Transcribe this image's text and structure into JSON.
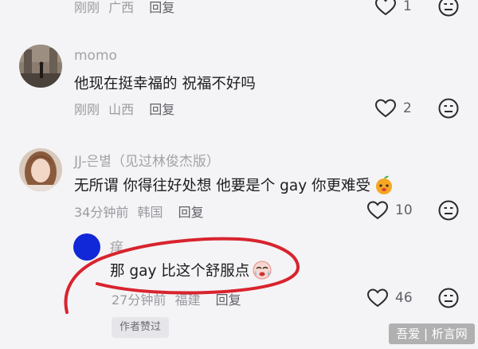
{
  "comments": [
    {
      "time": "刚刚",
      "region": "广西",
      "reply": "回复",
      "likes": "1"
    },
    {
      "name": "momo",
      "text": "他现在挺幸福的  祝福不好吗",
      "time": "刚刚",
      "region": "山西",
      "reply": "回复",
      "likes": "2"
    },
    {
      "name": "JJ-은별（见过林俊杰版）",
      "text": "无所谓 你得往好处想 他要是个 gay 你更难受",
      "time": "34分钟前",
      "region": "韩国",
      "reply": "回复",
      "likes": "10"
    },
    {
      "name": "痒",
      "text": "那 gay 比这个舒服点",
      "time": "27分钟前",
      "region": "福建",
      "reply": "回复",
      "likes": "46",
      "badge": "作者赞过"
    }
  ],
  "watermark": "吾爱 | 析言网",
  "colors": {
    "annotation": "#d8242e",
    "avatar_blue": "#1028d8",
    "heart": "#2b2b2b"
  }
}
